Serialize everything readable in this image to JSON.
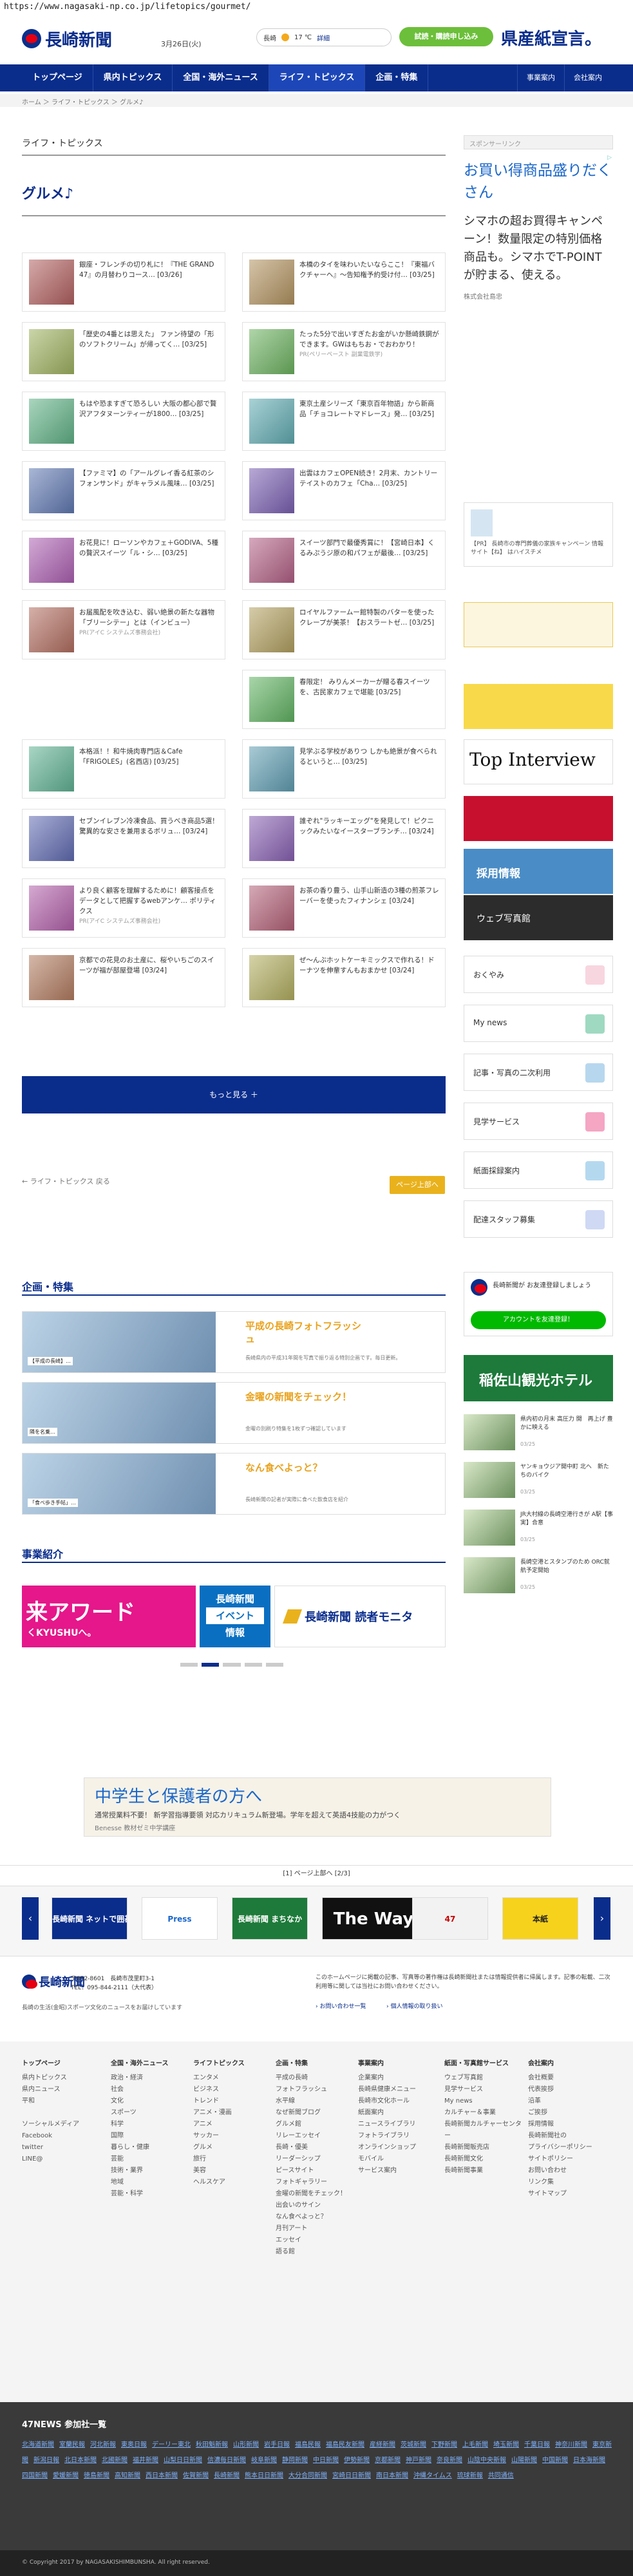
{
  "url": "https://www.nagasaki-np.co.jp/lifetopics/gourmet/",
  "header": {
    "logo": "長崎新聞",
    "date": "3月26日(火)",
    "weather_city": "長崎",
    "weather_temp": "17 ℃",
    "weather_link": "▶︎ 天気",
    "weather_detail": "詳細",
    "subscribe_btn": "試読・購読申し込み",
    "banner_text": "県産紙宣言。"
  },
  "nav": {
    "items": [
      "トップページ",
      "県内トピックス",
      "全国・海外ニュース",
      "ライフ・トピックス",
      "企画・特集"
    ],
    "right": [
      "会社案内",
      "事業案内"
    ]
  },
  "breadcrumb": "ホーム ＞ ライフ・トピックス ＞ グルメ♪",
  "section": {
    "label": "ライフ・トピックス",
    "title": "グルメ♪"
  },
  "articles": [
    {
      "text": "銀座・フレンチの切り札に！『THE GRAND 47』の月替わりコース… [03/26]",
      "pr": ""
    },
    {
      "text": "本橋のタイを味わいたいならここ！『東福バクチャーヘ』～告知権予約受け付… [03/25]",
      "pr": ""
    },
    {
      "text": "「歴史の4番とは思えた」 ファン待望の「形のソフトクリーム」が帰ってく… [03/25]",
      "pr": ""
    },
    {
      "text": "たった5分で出いすぎたお金がいか懸崎鉄鋼ができます。GWはもちお・でおわかり！",
      "pr": "PR(ペリーペースト 副業電鉄学)"
    },
    {
      "text": "もはや恐ますぎて恐ろしい 大阪の都心部で贅沢アフタヌーンティーが1800… [03/25]",
      "pr": ""
    },
    {
      "text": "東京土産シリーズ「東京百年物語」から新商品「チョコレートマドレース」発… [03/25]",
      "pr": ""
    },
    {
      "text": "【ファミマ】の「アールグレイ香る紅茶のシフォンサンド」がキャラメル風味… [03/25]",
      "pr": ""
    },
    {
      "text": "出雲はカフェOPEN続き！2月末、カントリーテイストのカフェ「Cha… [03/25]",
      "pr": ""
    },
    {
      "text": "お花見に！ローソンやカフェ＋GODIVA、5種の贅沢スイーツ「ル・シ… [03/25]",
      "pr": ""
    },
    {
      "text": "スイーツ部門で最優秀賞に！【宮崎日本】くるみぷうジ原の和パフェが最後… [03/25]",
      "pr": ""
    },
    {
      "text": "お届風配を吹き込む、弱い絶景の新たな器物「ブリーシテー」とは（インビュー）",
      "pr": "PR(アイC システムズ事務会社)"
    },
    {
      "text": "ロイヤルファームー館特製のバターを使ったクレープが美茶！【おスラートゼ… [03/25]",
      "pr": ""
    },
    {
      "text": "",
      "pr": ""
    },
    {
      "text": "春限定！ みりんメーカーが贈る春スイーツを、古民家カフェで堪能 [03/25]",
      "pr": ""
    },
    {
      "text": "本格派！！和牛焼肉専門店＆Cafe「FRIGOLES」(名西店) [03/25]",
      "pr": ""
    },
    {
      "text": "見学ぶる学校がありつ しかも絶景が食べられるというと… [03/25]",
      "pr": ""
    },
    {
      "text": "セブンイレブン冷凍食品、買うべき商品5選！驚異的な安さを兼用まるボリュ… [03/24]",
      "pr": ""
    },
    {
      "text": "誰ぞれ\"ラッキーエッグ\"を発見して！ピクニックみたいなイースターブランチ… [03/24]",
      "pr": ""
    },
    {
      "text": "より良く顧客を理解するために！顧客接点をデータとして把握するwebアンケ… ポリティクス",
      "pr": "PR(アイC システムズ事務会社)"
    },
    {
      "text": "お茶の香り豊う、山手山新造の3種の煎茶フレーバーを使ったフィナンシェ [03/24]",
      "pr": ""
    },
    {
      "text": "京都での花見のお土産に、桜やいちごのスイーツが福が部屋登場 [03/24]",
      "pr": ""
    },
    {
      "text": "ぜ〜んぶホットケーキミックスで作れる！ドーナツを伸輩すんもおまかせ [03/24]",
      "pr": ""
    }
  ],
  "more_btn": "もっと見る ＋",
  "back_link": "← ライフ・トピックス 戻る",
  "top_btn": "ページ上部へ",
  "features": {
    "title": "企画・特集",
    "items": [
      {
        "heading": "平成の長崎フォトフラッシュ",
        "desc": "長崎県内の平成31年間を写真で振り返る特別企画です。毎日更新。",
        "thumb_label": "【平成の長崎】…"
      },
      {
        "heading": "金曜の新聞をチェック！",
        "desc": "金曜の別刷り特集を1枚ずつ確認しています",
        "thumb_label": "隣を名乗…"
      },
      {
        "heading": "なん食べよっと？",
        "desc": "長崎新聞の記者が実際に食べた飲食店を紹介",
        "thumb_label": "「食べ歩き手帖」…"
      }
    ]
  },
  "business": {
    "title": "事業紹介",
    "banner1": "来アワード",
    "banner1_sub": "くKYUSHUへ。",
    "banner2_line1": "長崎新聞",
    "banner2_line2": "イベント",
    "banner2_line3": "情報",
    "banner3": "長崎新聞 読者モニタ"
  },
  "sidebar": {
    "sponsor_label": "スポンサーリンク",
    "ad_title": "お買い得商品盛りだくさん",
    "ad_body": "シマホの超お買得キャンペーン！数量限定の特別価格商品も。シマホでT-POINTが貯まる、使える。",
    "ad_company": "株式会社島忠",
    "pr_note": "【PR】 長崎市の専門葬儀の家族キャンペーン 情報サイト【ね】 はハイスチメ",
    "top_interview": "Top Interview",
    "recruit_btn": "採用情報",
    "shop_btn": "ウェブ写真館",
    "menu": [
      "おくやみ",
      "My news",
      "記事・写真の二次利用",
      "見学サービス",
      "紙面採録案内",
      "配達スタッフ募集"
    ],
    "line_note": "長崎新聞が お友達登録しましょう",
    "line_btn": "アカウントを友達登録！",
    "hotel": "稲佐山観光ホテル",
    "news": [
      {
        "text": "県内初の月末 高圧力 開　再上げ 豊かに映える",
        "date": "03/25"
      },
      {
        "text": "ヤンキョウジア開中町 北へ　新たちのバイク",
        "date": "03/25"
      },
      {
        "text": "JR大村線の長崎空港行きが A駅【事実】合意",
        "date": "03/25"
      },
      {
        "text": "長崎空港とスタンプのため ORC就航予定開始",
        "date": "03/25"
      }
    ]
  },
  "ad_bottom": {
    "line1": "中学生と保護者の方へ",
    "line2": "通常授業料不要！ 新学習指導要領 対応カリキュラム新登場。学年を超えて英語4技能の力がつく",
    "line3": "Benesse 教材ゼミ中学講座"
  },
  "pagination": "[1] ページ上部へ [2/3]",
  "carousel": [
    "長崎新聞 ネットで囲碁",
    "Press",
    "長崎新聞 まちなか",
    "The Way",
    "47",
    "本紙"
  ],
  "footer": {
    "logo": "長崎新聞",
    "address": "〒852-8601　長崎市茂里町3-1",
    "tel": "TEL：095-844-2111（大代表）",
    "catch": "長崎の生活(金昭)スポーツ文化のニュースをお届けしています",
    "notice": "このホームページに掲載の記事、写真等の著作権は長崎新聞社または情報提供者に帰属します。記事の転載、二次利用等に関しては当社にお問い合わせください。",
    "link1": "› お問い合わせ一覧",
    "link2": "› 個人情報の取り扱い",
    "cols": [
      {
        "h": "トップページ",
        "items": [
          "県内トピックス",
          "県内ニュース",
          "平和",
          "",
          "ソーシャルメディア",
          "Facebook",
          "twitter",
          "LINE@"
        ]
      },
      {
        "h": "全国・海外ニュース",
        "items": [
          "政治・経済",
          "社会",
          "文化",
          "スポーツ",
          "科学",
          "国際",
          "暮らし・健康",
          "芸能",
          "技術・業界",
          "地域",
          "芸能・科学"
        ]
      },
      {
        "h": "ライフトピックス",
        "items": [
          "エンタメ",
          "ビジネス",
          "トレンド",
          "アニメ・漫画",
          "アニメ",
          "サッカー",
          "グルメ",
          "旅行",
          "美容",
          "ヘルスケア"
        ]
      },
      {
        "h": "企画・特集",
        "items": [
          "平成の長崎",
          "フォトフラッシュ",
          "水平線",
          "なぜ新聞ブログ",
          "グルメ館",
          "リレーエッセイ",
          "長崎・優美",
          "リーダーシップ",
          "ピースサイト",
          "フォトギャラリー",
          "金曜の新聞をチェック！",
          "出会いのサイン",
          "なん食べよっと？",
          "月刊アート",
          "エッセイ",
          "語る館"
        ]
      },
      {
        "h": "事業案内",
        "items": [
          "企業案内",
          "長崎県健康メニュー",
          "長崎市文化ホール",
          "紙面案内",
          "ニュースライブラリ",
          "フォトライブラリ",
          "オンラインショップ",
          "モバイル",
          "サービス案内"
        ]
      },
      {
        "h": "紙面・写真館サービス",
        "items": [
          "ウェブ写真館",
          "見学サービス",
          "My news",
          "カルチャー＆事業",
          "長崎新聞カルチャーセンター",
          "長崎新聞販売店",
          "長崎新聞文化",
          "長崎新聞事業"
        ]
      },
      {
        "h": "会社案内",
        "items": [
          "会社概要",
          "代表挨拶",
          "沿革",
          "ご挨拶",
          "採用情報",
          "長崎新聞社の",
          "プライバシーポリシー",
          "サイトポリシー",
          "お問い合わせ",
          "リンク集",
          "サイトマップ"
        ]
      }
    ],
    "n47_title": "47NEWS 参加社一覧",
    "n47": [
      "北海道新聞",
      "室蘭民報",
      "河北新報",
      "東奥日報",
      "デーリー東北",
      "秋田魁新報",
      "山形新聞",
      "岩手日報",
      "福島民報",
      "福島民友新聞",
      "産経新聞",
      "茨城新聞",
      "下野新聞",
      "上毛新聞",
      "埼玉新聞",
      "千葉日報",
      "神奈川新聞",
      "東京新聞",
      "新潟日報",
      "北日本新聞",
      "北國新聞",
      "福井新聞",
      "山梨日日新聞",
      "信濃毎日新聞",
      "岐阜新聞",
      "静岡新聞",
      "中日新聞",
      "伊勢新聞",
      "京都新聞",
      "神戸新聞",
      "奈良新聞",
      "山陰中央新報",
      "山陽新聞",
      "中国新聞",
      "日本海新聞",
      "四国新聞",
      "愛媛新聞",
      "徳島新聞",
      "高知新聞",
      "西日本新聞",
      "佐賀新聞",
      "長崎新聞",
      "熊本日日新聞",
      "大分合同新聞",
      "宮崎日日新聞",
      "南日本新聞",
      "沖縄タイムス",
      "琉球新報",
      "共同通信"
    ],
    "copyright": "© Copyright 2017 by NAGASAKISHIMBUNSHA. All right reserved."
  },
  "colors": {
    "navy": "#0a2d8c",
    "red": "#e60012",
    "gold": "#e9b21d",
    "green": "#2e8b3d"
  }
}
